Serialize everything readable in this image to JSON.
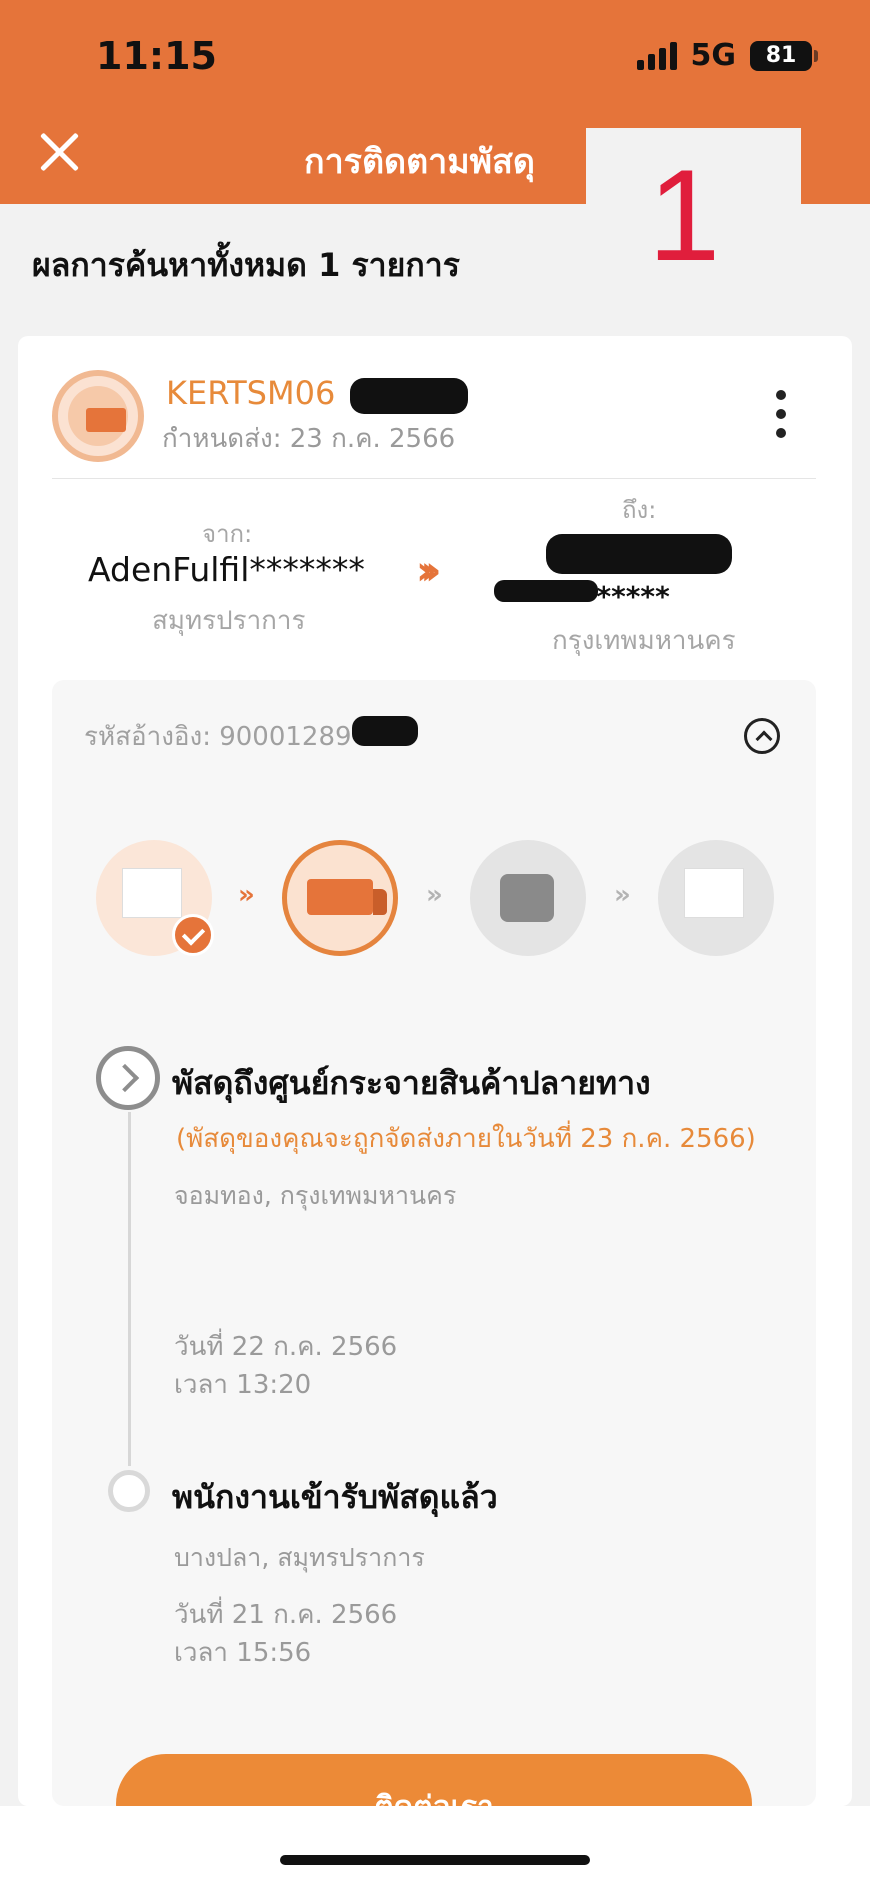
{
  "status_bar": {
    "time": "11:15",
    "network": "5G",
    "battery": "81"
  },
  "header": {
    "title": "การติดตามพัสดุ"
  },
  "overlay_number": "1",
  "results_text": "ผลการค้นหาทั้งหมด 1 รายการ",
  "parcel": {
    "tracking_no": "KERTSM06",
    "due_date": "กำหนดส่ง: 23 ก.ค. 2566",
    "from_label": "จาก:",
    "from_name": "AdenFulfil*******",
    "from_city": "สมุทรปราการ",
    "to_label": "ถึง:",
    "to_masked": "************",
    "to_city": "กรุงเทพมหานคร",
    "reference": "รหัสอ้างอิง: 90001289"
  },
  "steps": [
    "picked-up",
    "in-transit",
    "out-for-delivery",
    "delivered"
  ],
  "timeline": [
    {
      "title": "พัสดุถึงศูนย์กระจายสินค้าปลายทาง",
      "note": "(พัสดุของคุณจะถูกจัดส่งภายในวันที่ 23 ก.ค. 2566)",
      "location": "จอมทอง, กรุงเทพมหานคร",
      "date": "วันที่ 22 ก.ค. 2566",
      "time": "เวลา 13:20"
    },
    {
      "title": "พนักงานเข้ารับพัสดุแล้ว",
      "location": "บางปลา, สมุทรปราการ",
      "date": "วันที่ 21 ก.ค. 2566",
      "time": "เวลา 15:56"
    }
  ],
  "contact_button": "ติดต่อเรา",
  "colors": {
    "accent": "#e5743a",
    "accent_text": "#e78a3a",
    "overlay_red": "#e01e3c"
  }
}
